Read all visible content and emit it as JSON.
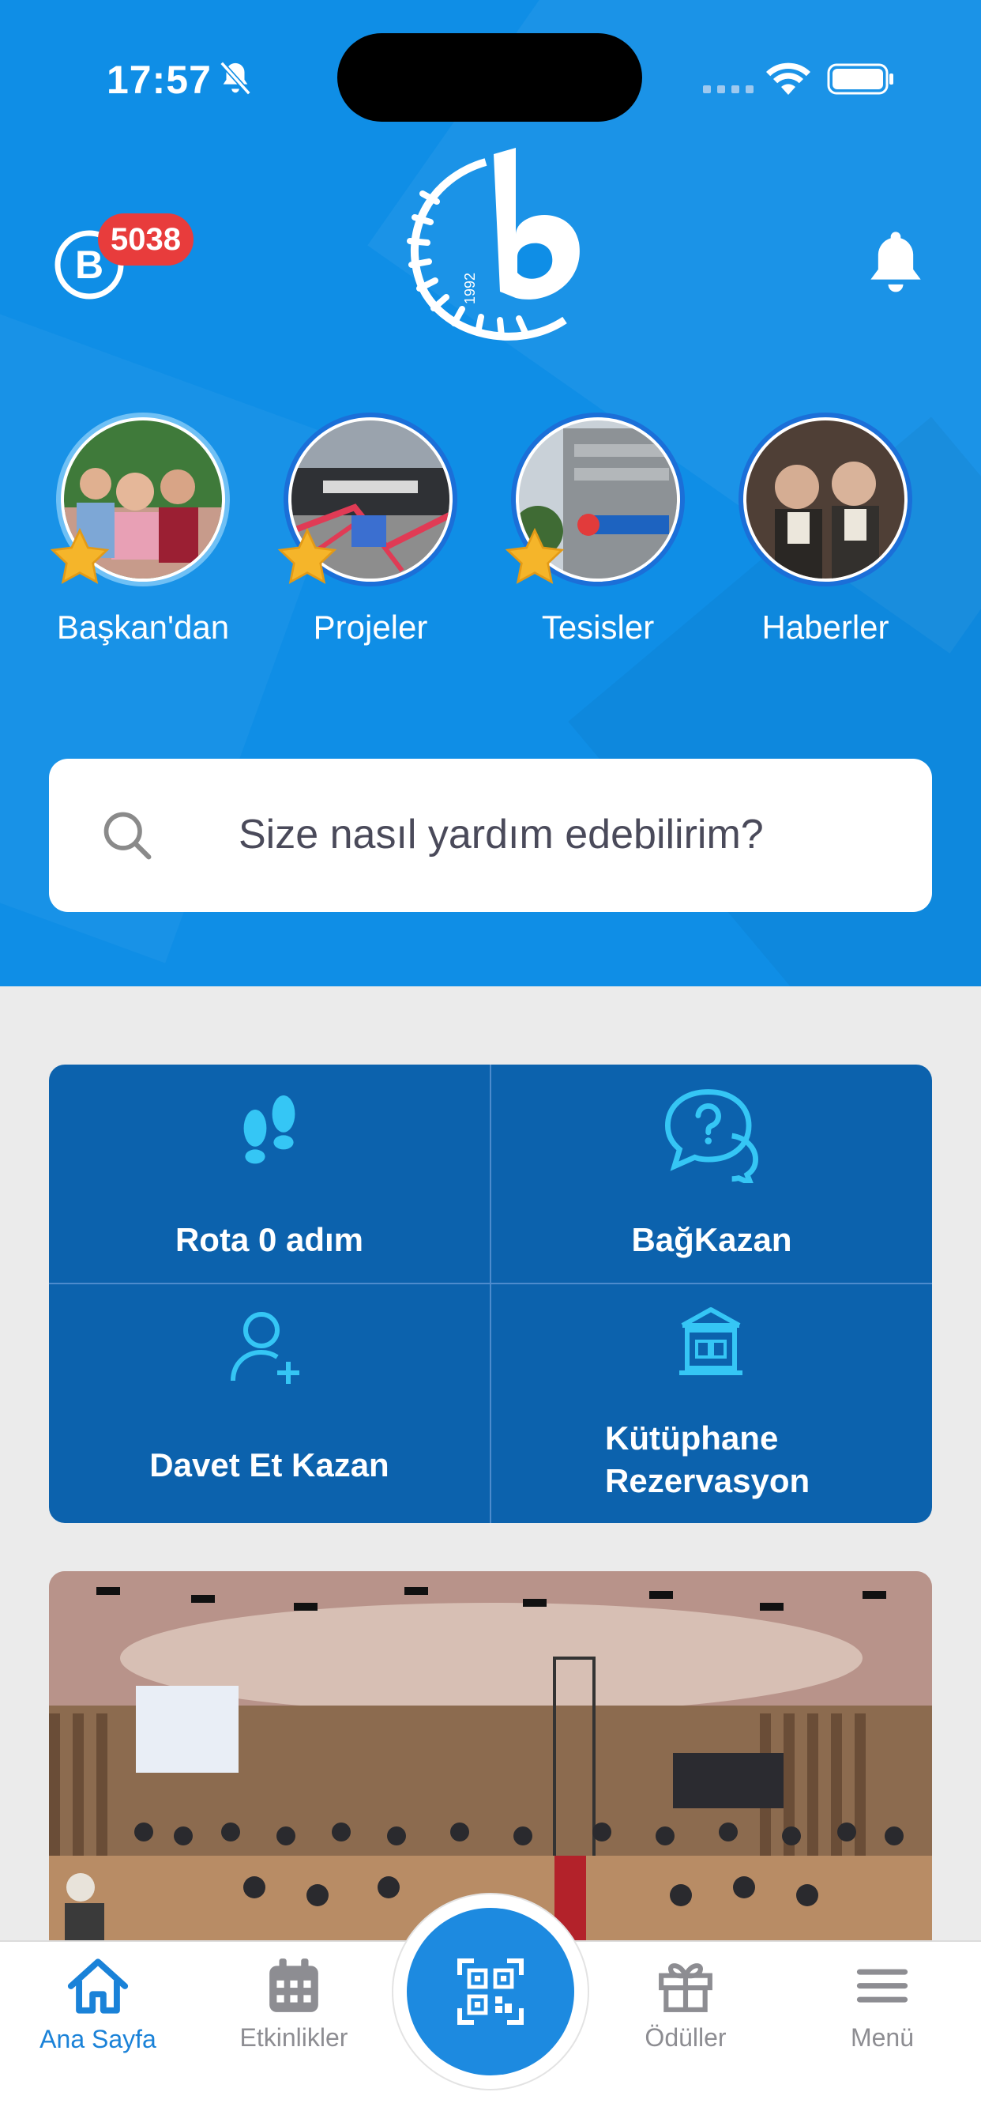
{
  "status_bar": {
    "time": "17:57"
  },
  "header": {
    "points_badge": "5038"
  },
  "stories": [
    {
      "label": "Başkan'dan",
      "starred": true
    },
    {
      "label": "Projeler",
      "starred": true
    },
    {
      "label": "Tesisler",
      "starred": true
    },
    {
      "label": "Haberler",
      "starred": false
    }
  ],
  "search": {
    "placeholder": "Size nasıl yardım edebilirim?"
  },
  "actions": [
    {
      "label": "Rota 0 adım",
      "icon": "footsteps-icon"
    },
    {
      "label": "BağKazan",
      "icon": "question-chat-icon"
    },
    {
      "label": "Davet Et Kazan",
      "icon": "add-user-icon"
    },
    {
      "label_line1": "Kütüphane",
      "label_line2": "Rezervasyon",
      "icon": "library-icon"
    }
  ],
  "tabbar": {
    "home": "Ana Sayfa",
    "events": "Etkinlikler",
    "rewards": "Ödüller",
    "menu": "Menü"
  },
  "colors": {
    "hero": "#0f8ee6",
    "tile": "#0c62ad",
    "accent": "#1a82d8",
    "badge": "#e83c3c",
    "tile_icon": "#35c6f5"
  }
}
